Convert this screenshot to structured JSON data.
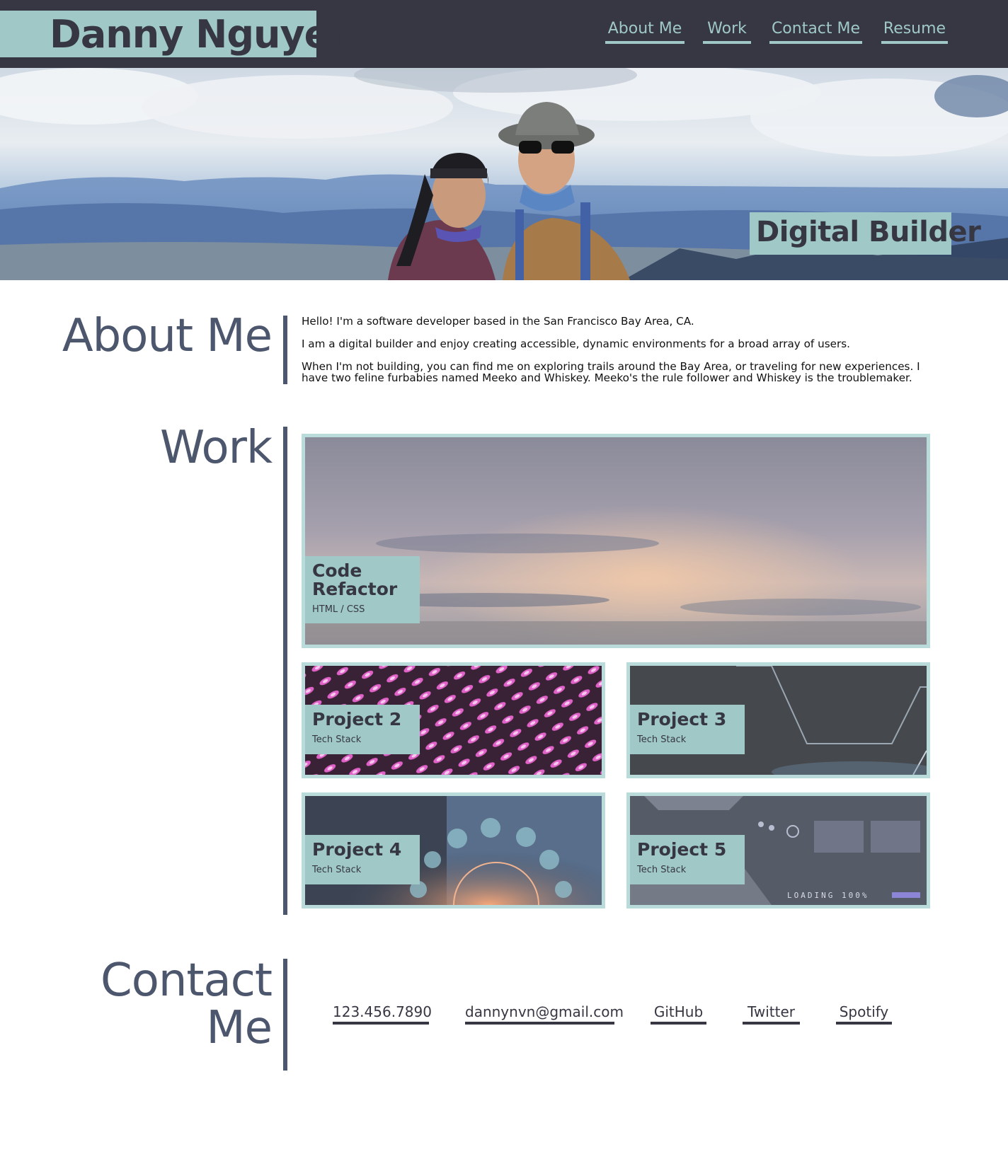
{
  "header": {
    "name": "Danny Nguyen",
    "nav": [
      "About Me",
      "Work",
      "Contact Me",
      "Resume"
    ]
  },
  "hero": {
    "tagline": "Digital Builder"
  },
  "about": {
    "title": "About Me",
    "paragraphs": [
      "Hello! I'm a software developer based in the San Francisco Bay Area, CA.",
      "I am a digital builder and enjoy creating accessible, dynamic environments for a broad array of users.",
      "When I'm not building, you can find me on exploring trails around the Bay Area, or traveling for new experiences. I have two feline furbabies named Meeko and Whiskey. Meeko's the rule follower and Whiskey is the troublemaker."
    ]
  },
  "work": {
    "title": "Work",
    "projects": [
      {
        "title": "Code Refactor",
        "stack": "HTML / CSS"
      },
      {
        "title": "Project 2",
        "stack": "Tech Stack"
      },
      {
        "title": "Project 3",
        "stack": "Tech Stack"
      },
      {
        "title": "Project 4",
        "stack": "Tech Stack"
      },
      {
        "title": "Project 5",
        "stack": "Tech Stack"
      }
    ],
    "overlay_text": "LOADING 100%"
  },
  "contact": {
    "title_line1": "Contact",
    "title_line2": "Me",
    "links": [
      "123.456.7890",
      "dannynvn@gmail.com",
      "GitHub",
      "Twitter",
      "Spotify"
    ]
  },
  "colors": {
    "header_bg": "#363742",
    "accent": "#9fc8c7",
    "card_border": "#b9dcdb",
    "heading": "#4c566d"
  }
}
